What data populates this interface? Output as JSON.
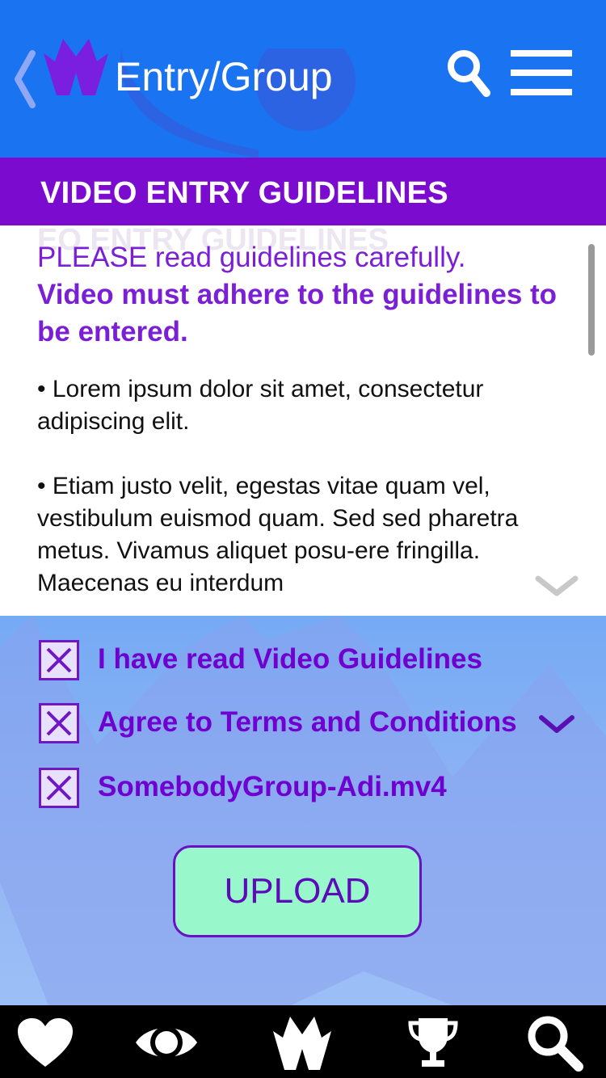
{
  "header": {
    "title": "Entry/Group",
    "icons": [
      "back-chevron-icon",
      "app-logo-icon",
      "search-icon",
      "menu-icon"
    ]
  },
  "banner": {
    "title": "VIDEO ENTRY GUIDELINES"
  },
  "content": {
    "ghost_text": "EO ENTRY GUIDELINES",
    "intro_plain": "PLEASE read guidelines carefully.",
    "intro_bold": "Video must adhere to the guidelines to be entered.",
    "bullet_1": "• Lorem ipsum dolor sit amet, consectetur adipiscing elit.",
    "bullet_2": "• Etiam justo velit, egestas vitae quam vel, vestibulum euismod quam. Sed sed pharetra metus. Vivamus aliquet posu-ere fringilla. Maecenas eu interdum"
  },
  "form": {
    "checkboxes": [
      {
        "label": "I have read Video Guidelines",
        "checked": true
      },
      {
        "label": "Agree to Terms and Conditions",
        "checked": true
      },
      {
        "label": "SomebodyGroup-Adi.mv4",
        "checked": true
      }
    ],
    "upload_label": "UPLOAD"
  },
  "bottom_nav": {
    "items": [
      "heart-icon",
      "eye-icon",
      "logo-icon",
      "trophy-icon",
      "search-icon"
    ]
  },
  "colors": {
    "header_blue": "#1a73f0",
    "banner_purple": "#7b0ccf",
    "text_purple": "#7b1fd6",
    "upload_green": "#98f8cc",
    "nav_black": "#000000"
  }
}
